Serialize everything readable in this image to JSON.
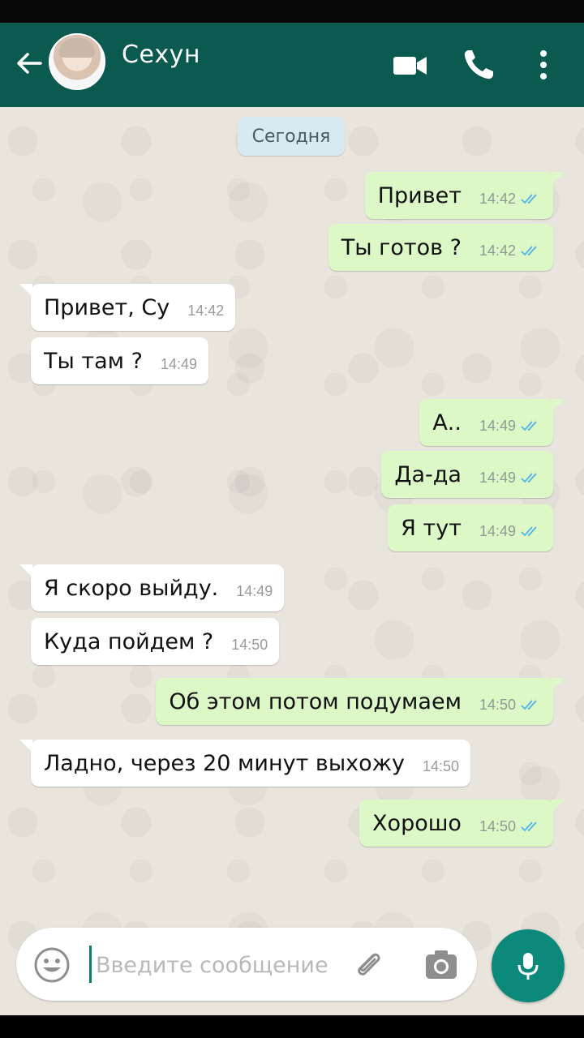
{
  "header": {
    "contact_name": "Сехун",
    "icons": {
      "back": "arrow-left-icon",
      "video": "video-camera-icon",
      "call": "phone-icon",
      "menu": "more-vertical-icon"
    }
  },
  "chat": {
    "date_label": "Сегодня",
    "messages": [
      {
        "dir": "out",
        "text": "Привет",
        "time": "14:42",
        "read": true
      },
      {
        "dir": "out",
        "text": "Ты готов ?",
        "time": "14:42",
        "read": true
      },
      {
        "dir": "in",
        "text": "Привет, Су",
        "time": "14:42"
      },
      {
        "dir": "in",
        "text": "Ты там ?",
        "time": "14:49"
      },
      {
        "dir": "out",
        "text": "А..",
        "time": "14:49",
        "read": true
      },
      {
        "dir": "out",
        "text": "Да-да",
        "time": "14:49",
        "read": true
      },
      {
        "dir": "out",
        "text": "Я тут",
        "time": "14:49",
        "read": true
      },
      {
        "dir": "in",
        "text": "Я скоро выйду.",
        "time": "14:49"
      },
      {
        "dir": "in",
        "text": "Куда пойдем ?",
        "time": "14:50"
      },
      {
        "dir": "out",
        "text": "Об этом потом подумаем",
        "time": "14:50",
        "read": true
      },
      {
        "dir": "in",
        "text": "Ладно, через 20 минут выхожу",
        "time": "14:50"
      },
      {
        "dir": "out",
        "text": "Хорошо",
        "time": "14:50",
        "read": true
      }
    ]
  },
  "composer": {
    "placeholder": "Введите сообщение",
    "value": "",
    "icons": {
      "emoji": "emoji-icon",
      "attach": "paperclip-icon",
      "camera": "camera-icon",
      "mic": "microphone-icon"
    }
  },
  "colors": {
    "header": "#0b5a50",
    "outgoing": "#dcf8c6",
    "incoming": "#ffffff",
    "read_ticks": "#4fb6ec",
    "fab": "#0b8a7c"
  }
}
